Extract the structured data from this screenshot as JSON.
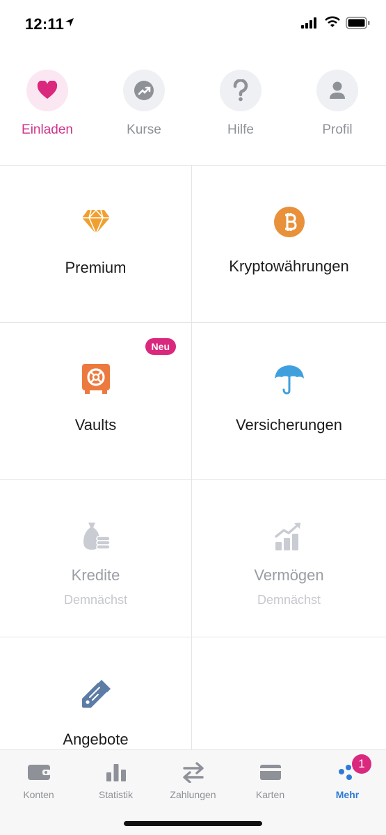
{
  "status_bar": {
    "time": "12:11"
  },
  "quick_actions": [
    {
      "label": "Einladen",
      "icon": "heart-icon",
      "active": true
    },
    {
      "label": "Kurse",
      "icon": "trend-icon",
      "active": false
    },
    {
      "label": "Hilfe",
      "icon": "question-icon",
      "active": false
    },
    {
      "label": "Profil",
      "icon": "person-icon",
      "active": false
    }
  ],
  "tiles": [
    {
      "label": "Premium",
      "icon": "diamond-icon",
      "color": "#f0a030"
    },
    {
      "label": "Kryptowährungen",
      "icon": "bitcoin-icon",
      "color": "#e8913a"
    },
    {
      "label": "Vaults",
      "icon": "safe-icon",
      "color": "#ec7a3e",
      "badge": "Neu"
    },
    {
      "label": "Versicherungen",
      "icon": "umbrella-icon",
      "color": "#3fa0dd"
    },
    {
      "label": "Kredite",
      "sub": "Demnächst",
      "icon": "money-bag-icon",
      "color": "#c9ccd2"
    },
    {
      "label": "Vermögen",
      "sub": "Demnächst",
      "icon": "growth-chart-icon",
      "color": "#c9ccd2"
    },
    {
      "label": "Angebote",
      "icon": "coupon-icon",
      "color": "#5c7ca6"
    }
  ],
  "tabbar": {
    "items": [
      {
        "label": "Konten",
        "icon": "wallet-icon"
      },
      {
        "label": "Statistik",
        "icon": "bar-chart-icon"
      },
      {
        "label": "Zahlungen",
        "icon": "transfer-icon"
      },
      {
        "label": "Karten",
        "icon": "card-icon"
      },
      {
        "label": "Mehr",
        "icon": "more-dots-icon",
        "active": true,
        "badge": "1"
      }
    ]
  },
  "colors": {
    "accent_pink": "#d9287d",
    "active_blue": "#2e7bd6",
    "muted": "#8e9198"
  }
}
